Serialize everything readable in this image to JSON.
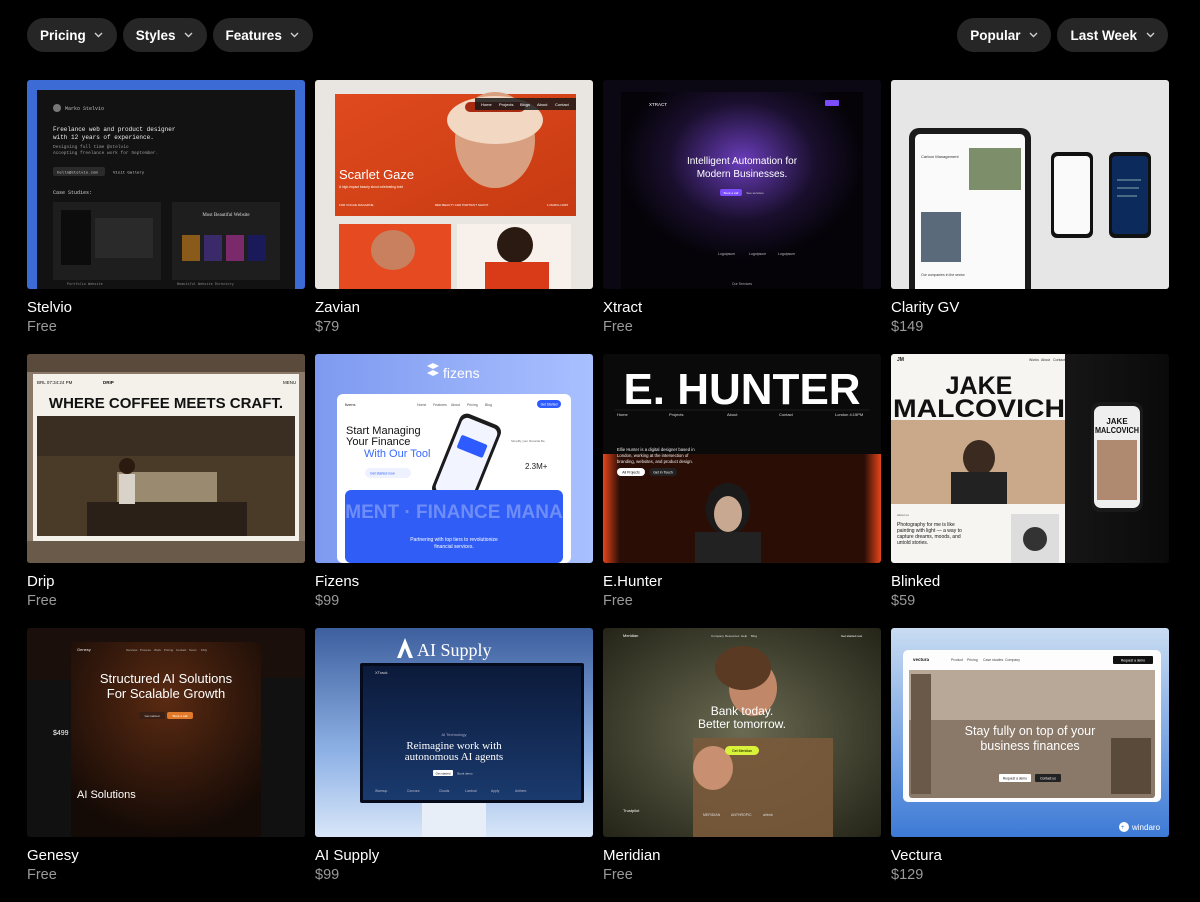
{
  "filters": {
    "left": [
      {
        "label": "Pricing"
      },
      {
        "label": "Styles"
      },
      {
        "label": "Features"
      }
    ],
    "right": [
      {
        "label": "Popular"
      },
      {
        "label": "Last Week"
      }
    ]
  },
  "templates": [
    {
      "title": "Stelvio",
      "price": "Free",
      "preview": {
        "brand": "Marko Stelvio",
        "headline_1": "Freelance web and product designer",
        "headline_2": "with 12 years of experience.",
        "sub_1": "Designing full time @stelvio",
        "sub_2": "Accepting freelance work for September.",
        "email": "hello@stelvio.com",
        "gallery": "Visit Gallery",
        "section": "Case Studies:",
        "case_title": "Most Beautiful Website Built In Framer",
        "case_a": "Portfolio Website",
        "case_b": "Beautiful Website Directory"
      }
    },
    {
      "title": "Zavian",
      "price": "$79",
      "preview": {
        "nav": [
          "Home",
          "Projects",
          "Blogs",
          "About",
          "Contact"
        ],
        "heading": "Scarlet Gaze",
        "body": "A high-impact beauty shoot celebrating bold femininity with saturated red-orange lighting, confident poses, and sharp styling.",
        "meta_1": "FOR VOGUE MAGAZINE",
        "meta_2": "RED BEAUTY AND PORTRAIT SHOOT",
        "meta_3": "1 MARCH 2025"
      }
    },
    {
      "title": "Xtract",
      "price": "Free",
      "preview": {
        "brand": "XTRACT",
        "headline_1": "Intelligent Automation for",
        "headline_2": "Modern Businesses.",
        "cta": "Book a call",
        "link": "See services",
        "logos": [
          "Logoipsum",
          "Logoipsum",
          "Logoipsum"
        ],
        "footer": "Our Services"
      }
    },
    {
      "title": "Clarity GV",
      "price": "$149",
      "preview": {
        "label": "Carbon Management",
        "caption": "Our companies in the sector"
      }
    },
    {
      "title": "Drip",
      "price": "Free",
      "preview": {
        "time": "BRL 07:34:24 PM",
        "brand": "DRIP",
        "menu": "MENU",
        "headline": "WHERE COFFEE MEETS CRAFT."
      }
    },
    {
      "title": "Fizens",
      "price": "$99",
      "preview": {
        "logo": "fizens",
        "small_logo": "fizens",
        "nav": [
          "Home",
          "Features",
          "About",
          "Pricing",
          "Blog"
        ],
        "cta": "Get Started",
        "headline_1": "Start Managing",
        "headline_2": "Your Finance",
        "headline_3": "With Our Tool",
        "button": "Get started now",
        "stat": "2.3M+",
        "side_text": "Simplify your financial life. Our intuitive app makes managing your money effortless.",
        "marquee": "MENT · FINANCE MANA",
        "footer_1": "Partnering with top tiers to revolutionize",
        "footer_2": "financial services."
      }
    },
    {
      "title": "E.Hunter",
      "price": "Free",
      "preview": {
        "logo": "E. HUNTER",
        "nav": [
          "Home",
          "Projects",
          "About",
          "Contact"
        ],
        "location": "London 4:15PM",
        "bio": "Ellie Hunter is a digital designer based in London, working at the intersection of branding, websites, and product design.",
        "btn_1": "All Projects",
        "btn_2": "Get in Touch"
      }
    },
    {
      "title": "Blinked",
      "price": "$59",
      "preview": {
        "initials": "JM",
        "nav": [
          "Works",
          "About",
          "Contact"
        ],
        "name_1": "JAKE",
        "name_2": "MALCOVICH",
        "phone_name_1": "JAKE",
        "phone_name_2": "MALCOVICH",
        "quote": "Photography for me is like painting with light — a way to capture dreams, moods, and untold stories.",
        "about": "About us"
      }
    },
    {
      "title": "Genesy",
      "price": "Free",
      "preview": {
        "brand": "Genesy",
        "nav": [
          "Services",
          "Process",
          "Work",
          "Pricing",
          "Contact",
          "Team",
          "FAQ"
        ],
        "headline_1": "Structured AI Solutions",
        "headline_2": "For Scalable Growth",
        "btn_1": "Get started",
        "btn_2": "Book a call",
        "price": "$499",
        "section": "AI Solutions"
      }
    },
    {
      "title": "AI Supply",
      "price": "$99",
      "preview": {
        "logo": "AI Supply",
        "brand": "XTrack",
        "tag": "AI Technology",
        "headline_1": "Reimagine work with",
        "headline_2": "autonomous AI agents",
        "btn_1": "Get started",
        "btn_2": "Book demo",
        "logos": [
          "Warmup",
          "Convora",
          "Clouds",
          "Luminal",
          "Apply",
          "Anthem"
        ]
      }
    },
    {
      "title": "Meridian",
      "price": "Free",
      "preview": {
        "brand": "Meridian",
        "nav": [
          "Company",
          "Resources",
          "Help",
          "Blog"
        ],
        "cta": "Get started now",
        "headline_1": "Bank today.",
        "headline_2": "Better tomorrow.",
        "button": "Get Meridian",
        "logos": [
          "Trustpilot",
          "MERIDIAN",
          "ANTHROPIC",
          "airbnb"
        ]
      }
    },
    {
      "title": "Vectura",
      "price": "$129",
      "preview": {
        "brand": "vectura",
        "nav": [
          "Product",
          "Pricing",
          "Case studies",
          "Company"
        ],
        "cta": "Request a demo",
        "headline_1": "Stay fully on top of your",
        "headline_2": "business finances",
        "btn_1": "Request a demo",
        "btn_2": "Contact us",
        "badge": "windaro"
      }
    }
  ]
}
